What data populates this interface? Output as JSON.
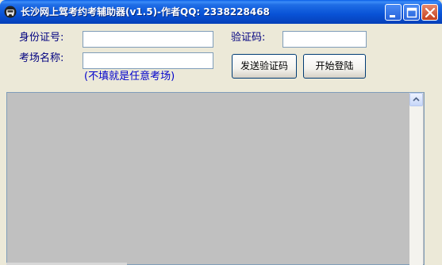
{
  "window": {
    "title": "长沙网上驾考约考辅助器(v1.5)-作者QQ: 2338228468"
  },
  "form": {
    "id_label": "身份证号:",
    "id_value": "",
    "code_label": "验证码:",
    "code_value": "",
    "venue_label": "考场名称:",
    "venue_value": "",
    "venue_hint": "(不填就是任意考场)"
  },
  "buttons": {
    "send_code": "发送验证码",
    "start_login": "开始登陆"
  },
  "log": {
    "content": ""
  },
  "icons": {
    "app": "car-icon",
    "minimize": "minimize-icon",
    "maximize": "maximize-icon",
    "close": "close-icon",
    "scroll_up": "scroll-up-arrow-icon"
  },
  "colors": {
    "title_bar": "#0852D6",
    "window_bg": "#ECE9D8",
    "label": "#000080",
    "hint": "#0000CC",
    "log_bg": "#C0C0C0"
  }
}
